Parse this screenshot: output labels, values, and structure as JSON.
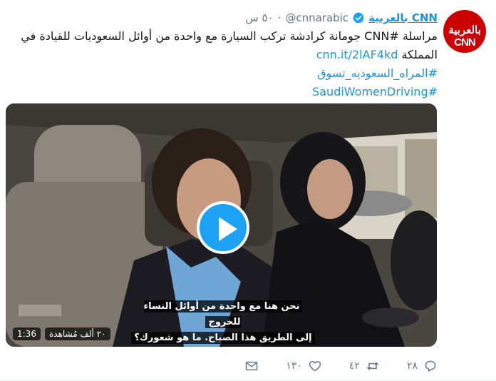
{
  "tweet": {
    "avatar_text": "بالعربية CNN",
    "display_name": "CNN بالعربية",
    "handle": "@cnnarabic",
    "separator": "·",
    "time": "٥٠ س",
    "body_line1": "مراسلة #CNN جومانة كرادشة تركب السيارة مع واحدة من أوائل السعوديات للقيادة في",
    "body_line2_text": "المملكة ",
    "body_line2_link": "cnn.it/2lAF4kd",
    "hashtag1": "#المراه_السعوديه_تسوق",
    "hashtag2": "#SaudiWomenDriving"
  },
  "video": {
    "subtitle_line1": "نحن هنا مع واحدة من أوائل النساء للخروج",
    "subtitle_line2": "إلى الطريق هذا الصباح. ما هو شعورك؟",
    "views": "٢٠ ألف مُشاهدة",
    "duration": "1:36"
  },
  "actions": {
    "reply_count": "٢٨",
    "retweet_count": "٤٢",
    "like_count": "١٣٠",
    "message_label": ""
  },
  "colors": {
    "link": "#1b95e0",
    "muted": "#657786",
    "play": "#1da1f2",
    "brand_red": "#cc0000"
  }
}
